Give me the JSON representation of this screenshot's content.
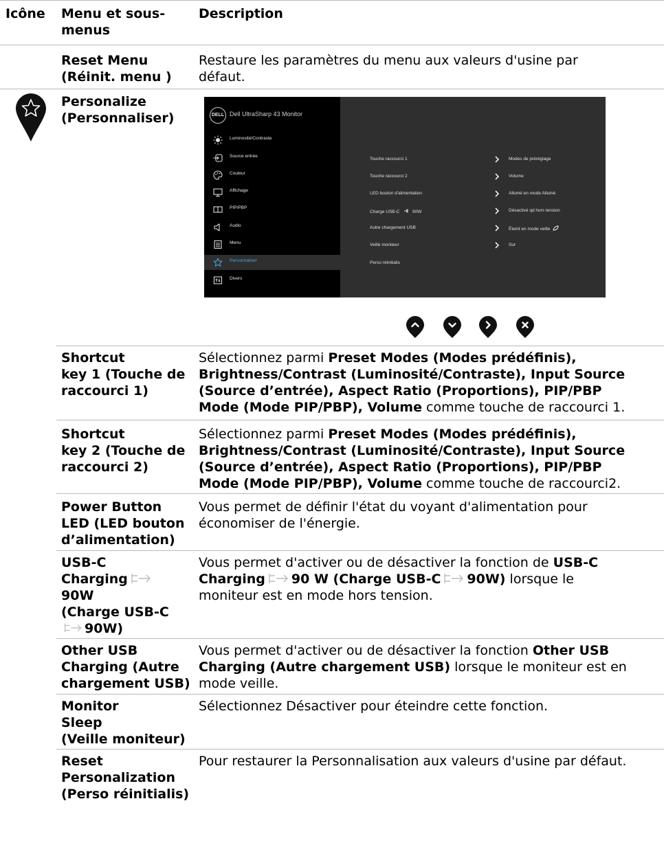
{
  "header": {
    "icon_col": "Icône",
    "menu_col_line1": "Menu et sous-",
    "menu_col_line2": "menus",
    "desc_col": "Description"
  },
  "rows": {
    "reset_menu": {
      "name1": "Reset Menu",
      "name2": "(Réinit. menu )",
      "desc1": "Restaure les paramètres du menu aux valeurs d'usine par",
      "desc2": "défaut."
    },
    "personalize": {
      "name1": "Personalize",
      "name2": "(Personnaliser)"
    },
    "shortcut1": {
      "name1": "Shortcut",
      "name2": "key 1 (Touche de",
      "name3": "raccourci 1)",
      "d1_a": "Sélectionnez parmi ",
      "d1_b": "Preset Modes (Modes prédéfinis),",
      "d2": "Brightness/Contrast (Luminosité/Contraste), Input Source",
      "d3": "(Source d’entrée), Aspect Ratio (Proportions), PIP/PBP",
      "d4_a": "Mode (Mode PIP/PBP), Volume",
      "d4_b": " comme touche de raccourci 1."
    },
    "shortcut2": {
      "name1": "Shortcut",
      "name2": "key 2 (Touche de",
      "name3": "raccourci 2)",
      "d1_a": "Sélectionnez parmi ",
      "d1_b": "Preset Modes (Modes prédéfinis),",
      "d2": "Brightness/Contrast (Luminosité/Contraste), Input Source",
      "d3": "(Source d’entrée), Aspect Ratio (Proportions), PIP/PBP",
      "d4_a": "Mode (Mode PIP/PBP), Volume",
      "d4_b": " comme touche de raccourci2."
    },
    "power_led": {
      "name1": "Power Button",
      "name2": "LED (LED bouton",
      "name3": "d’alimentation)",
      "desc1": "Vous permet de définir l'état du voyant d'alimentation pour",
      "desc2": "économiser de l'énergie."
    },
    "usbc": {
      "name1": "USB-C",
      "name2": "Charging",
      "name3": "90W",
      "name4": "(Charge USB-C",
      "name5": "90W)",
      "d1_a": "Vous permet d'activer ou de désactiver la fonction de ",
      "d1_b": "USB-C",
      "d2_a": "Charging",
      "d2_b": "90 W (Charge USB-C",
      "d2_c": "90W)",
      "d2_d": " lorsque le",
      "d3": "moniteur est en mode hors tension."
    },
    "other_usb": {
      "name1": "Other USB",
      "name2": "Charging (Autre",
      "name3": "chargement USB)",
      "d1_a": "Vous permet d'activer ou de désactiver la fonction ",
      "d1_b": "Other USB",
      "d2_a": "Charging (Autre chargement USB)",
      "d2_b": " lorsque le moniteur est en",
      "d3": "mode veille."
    },
    "monitor_sleep": {
      "name1": "Monitor",
      "name2": "Sleep",
      "name3": "(Veille moniteur)",
      "desc1": "Sélectionnez Désactiver pour éteindre cette fonction."
    },
    "reset_perso": {
      "name1": "Reset",
      "name2": "Personalization",
      "name3": "(Perso réinitialis)",
      "desc1": "Pour restaurer la Personnalisation aux valeurs d'usine par défaut."
    }
  },
  "osd": {
    "logo": "DELL",
    "title": "Dell UltraSharp 43 Monitor",
    "menu": [
      {
        "label": "Luminosité/Contraste",
        "icon": "brightness-icon"
      },
      {
        "label": "Source entrée",
        "icon": "input-source-icon"
      },
      {
        "label": "Couleur",
        "icon": "color-palette-icon"
      },
      {
        "label": "Affichage",
        "icon": "display-icon"
      },
      {
        "label": "PIP/PBP",
        "icon": "pip-pbp-icon"
      },
      {
        "label": "Audio",
        "icon": "speaker-icon"
      },
      {
        "label": "Menu",
        "icon": "menu-list-icon"
      },
      {
        "label": "Personnaliser",
        "icon": "star-icon"
      },
      {
        "label": "Divers",
        "icon": "others-icon"
      }
    ],
    "settings": [
      {
        "label": "Touche raccourci 1",
        "value": "Modes de préréglage"
      },
      {
        "label": "Touche raccourci 2",
        "value": "Volume"
      },
      {
        "label": "LED bouton d'alimentation",
        "value": "Allumé en mode Allumé"
      },
      {
        "label": "Charge USB-C",
        "label_suffix": "90W",
        "value": "Désactivé qd hors tension"
      },
      {
        "label": "Autre chargement USB",
        "value": "Éteint en mode veille"
      },
      {
        "label": "Veille moniteur",
        "value": "Sur"
      },
      {
        "label": "Perso réinitialis",
        "value": ""
      }
    ],
    "active_color": "#4aa3e0"
  },
  "nav_buttons": [
    "up-button-icon",
    "down-button-icon",
    "right-button-icon",
    "exit-button-icon"
  ]
}
